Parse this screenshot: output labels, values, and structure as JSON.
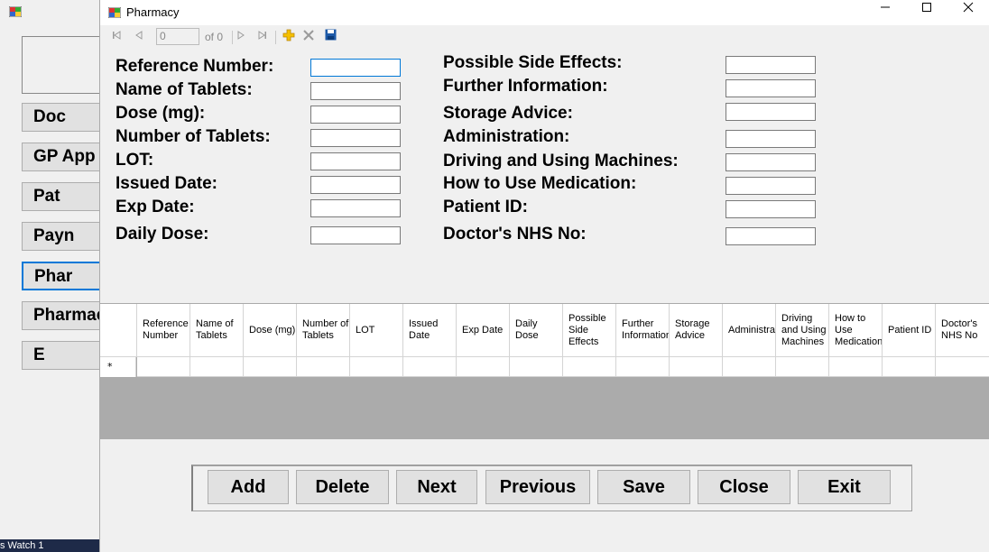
{
  "background_window": {
    "buttons": [
      "Doc",
      "GP App",
      "Pat",
      "Payn",
      "Phar",
      "Pharmac",
      "E"
    ],
    "taskbar_text": "s   Watch 1"
  },
  "window": {
    "title": "Pharmacy",
    "minimize": "—",
    "maximize": "☐",
    "close": "✕"
  },
  "navigator": {
    "position": "0",
    "of_label": "of 0"
  },
  "form": {
    "left_fields": [
      {
        "label": "Reference Number:",
        "value": ""
      },
      {
        "label": "Name of Tablets:",
        "value": ""
      },
      {
        "label": "Dose (mg):",
        "value": ""
      },
      {
        "label": "Number of Tablets:",
        "value": ""
      },
      {
        "label": "LOT:",
        "value": ""
      },
      {
        "label": "Issued Date:",
        "value": ""
      },
      {
        "label": "Exp Date:",
        "value": ""
      },
      {
        "label": "Daily Dose:",
        "value": ""
      }
    ],
    "right_fields": [
      {
        "label": "Possible Side Effects:",
        "value": ""
      },
      {
        "label": "Further Information:",
        "value": ""
      },
      {
        "label": "Storage Advice:",
        "value": ""
      },
      {
        "label": "Administration:",
        "value": ""
      },
      {
        "label": "Driving and Using Machines:",
        "value": ""
      },
      {
        "label": "How to Use Medication:",
        "value": ""
      },
      {
        "label": "Patient ID:",
        "value": ""
      },
      {
        "label": "Doctor's NHS No:",
        "value": ""
      }
    ]
  },
  "grid": {
    "columns": [
      "Reference Number",
      "Name of Tablets",
      "Dose (mg)",
      "Number of Tablets",
      "LOT",
      "Issued Date",
      "Exp Date",
      "Daily Dose",
      "Possible Side Effects",
      "Further Information",
      "Storage Advice",
      "Administration",
      "Driving and Using Machines",
      "How to Use Medication",
      "Patient ID",
      "Doctor's NHS No"
    ],
    "new_row_marker": "*"
  },
  "actions": [
    "Add",
    "Delete",
    "Next",
    "Previous",
    "Save",
    "Close",
    "Exit"
  ]
}
